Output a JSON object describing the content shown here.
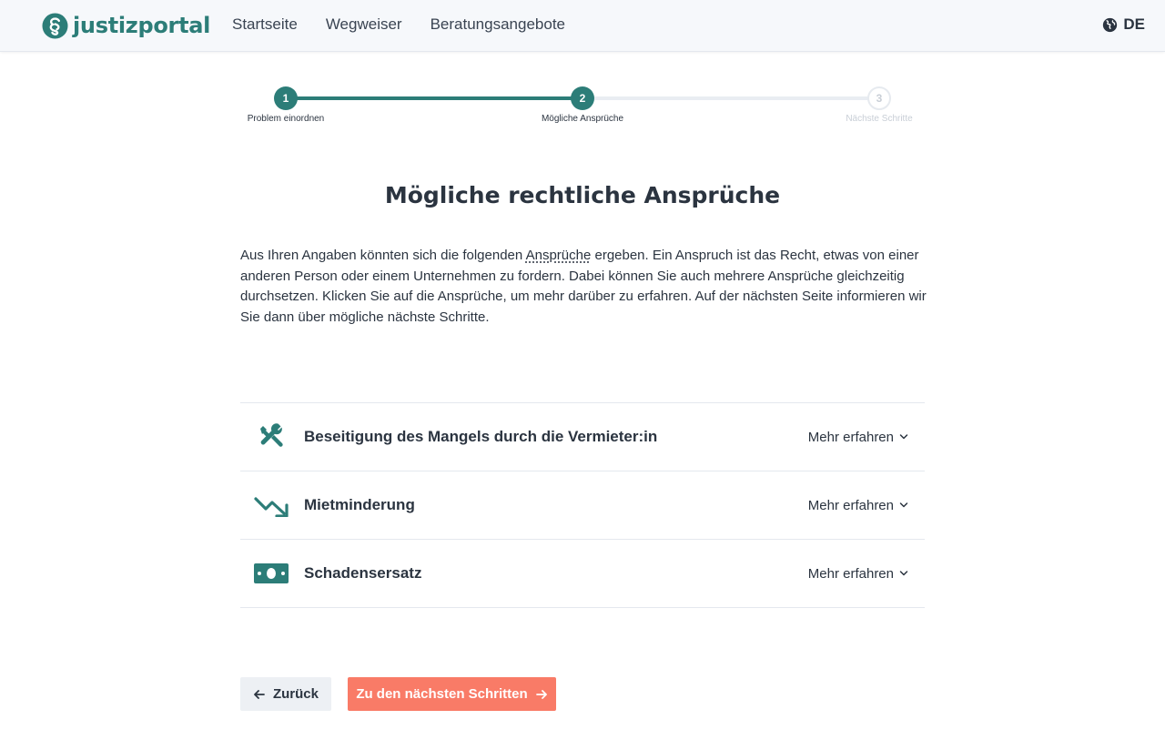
{
  "header": {
    "logo_text": "justizportal",
    "nav": [
      "Startseite",
      "Wegweiser",
      "Beratungsangebote"
    ],
    "language": "DE"
  },
  "stepper": {
    "steps": [
      {
        "number": "1",
        "label": "Problem einordnen",
        "state": "done"
      },
      {
        "number": "2",
        "label": "Mögliche Ansprüche",
        "state": "current"
      },
      {
        "number": "3",
        "label": "Nächste Schritte",
        "state": "upcoming"
      }
    ]
  },
  "main": {
    "title": "Mögliche rechtliche Ansprüche",
    "intro_before": "Aus Ihren Angaben könnten sich die folgenden ",
    "intro_term": "Ansprüche",
    "intro_after": " ergeben. Ein Anspruch ist das Recht, etwas von einer anderen Person oder einem Unternehmen zu fordern. Dabei können Sie auch mehrere Ansprüche gleichzeitig durchsetzen. Klicken Sie auf die Ansprüche, um mehr darüber zu erfahren. Auf der nächsten Seite informieren wir Sie dann über mögliche nächste Schritte.",
    "claims": [
      {
        "title": "Beseitigung des Mangels durch die Vermieter:in",
        "more_label": "Mehr erfahren",
        "icon": "tools-icon"
      },
      {
        "title": "Mietminderung",
        "more_label": "Mehr erfahren",
        "icon": "trend-down-icon"
      },
      {
        "title": "Schadensersatz",
        "more_label": "Mehr erfahren",
        "icon": "money-icon"
      }
    ]
  },
  "actions": {
    "back_label": "Zurück",
    "next_label": "Zu den nächsten Schritten"
  },
  "colors": {
    "brand": "#2c7d78",
    "cta": "#f97b67",
    "text": "#2b3440"
  }
}
